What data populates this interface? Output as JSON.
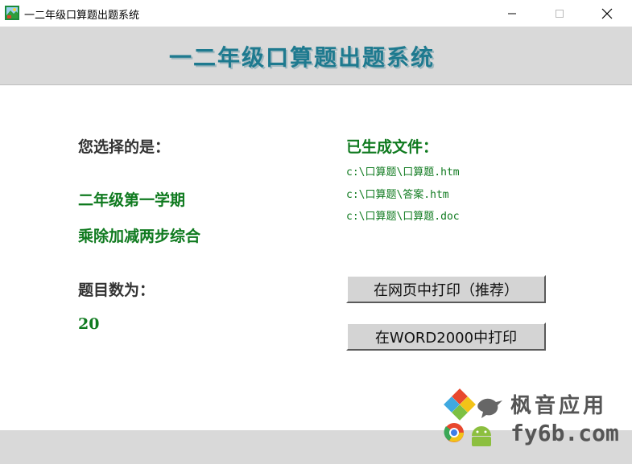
{
  "window": {
    "title": "一二年级口算题出题系统"
  },
  "header": {
    "title": "一二年级口算题出题系统"
  },
  "selection": {
    "heading": "您选择的是：",
    "grade": "二年级第一学期",
    "type": "乘除加减两步综合"
  },
  "count": {
    "heading": "题目数为：",
    "value": "20"
  },
  "files": {
    "heading": "已生成文件：",
    "items": [
      "c:\\口算题\\口算题.htm",
      "c:\\口算题\\答案.htm",
      "c:\\口算题\\口算题.doc"
    ]
  },
  "buttons": {
    "print_web": "在网页中打印（推荐）",
    "print_word": "在WORD2000中打印"
  },
  "watermark": {
    "line1": "枫音应用",
    "line2": "fy6b.com"
  },
  "colors": {
    "header_title": "#1e7a8f",
    "green_text": "#0f7a1f",
    "band_gray": "#d9d9d9"
  }
}
